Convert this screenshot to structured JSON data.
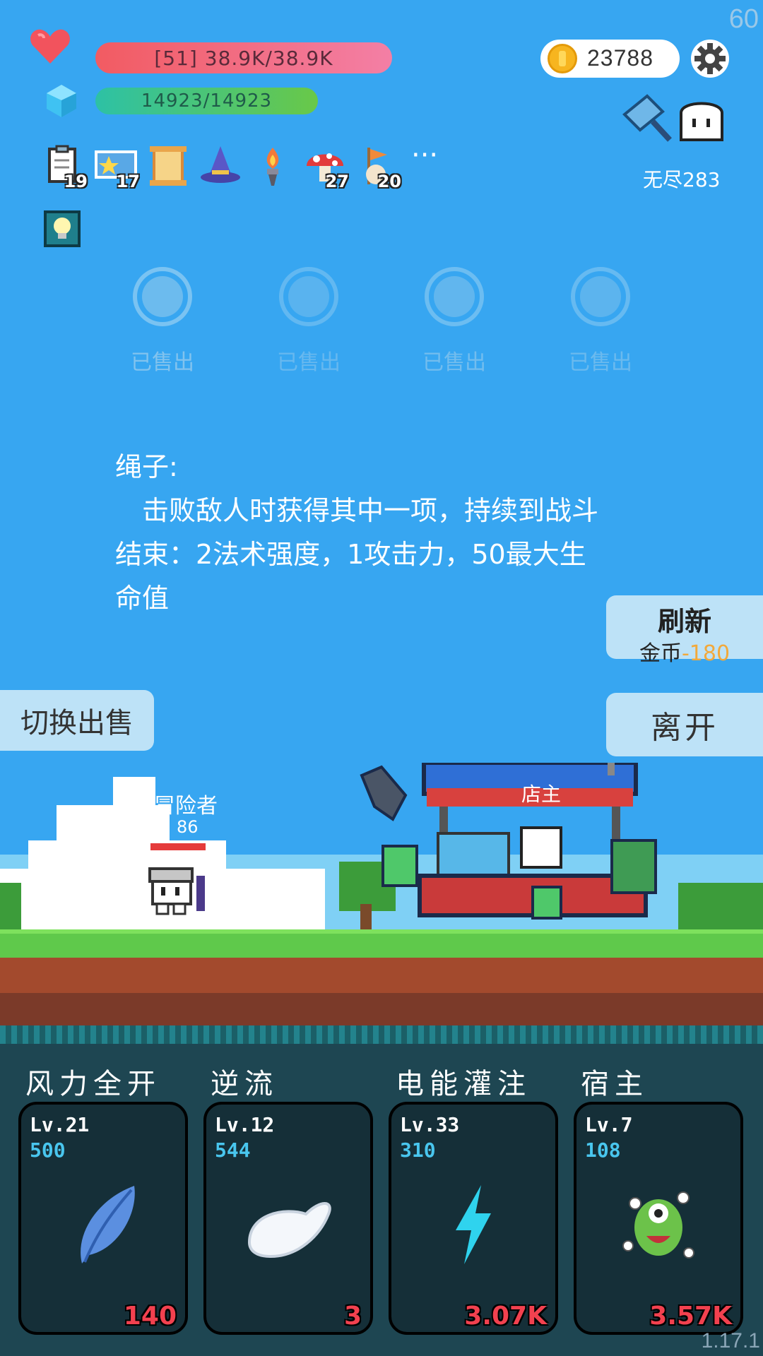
{
  "fps": "60",
  "version": "1.17.1",
  "status": {
    "hp_text": "[51] 38.9K/38.9K",
    "mp_text": "14923/14923",
    "gold": "23788"
  },
  "items": [
    {
      "icon": "quest-clipboard-icon",
      "count": "19"
    },
    {
      "icon": "star-card-icon",
      "count": "17"
    },
    {
      "icon": "scroll-icon",
      "count": ""
    },
    {
      "icon": "wizard-hat-icon",
      "count": ""
    },
    {
      "icon": "torch-icon",
      "count": ""
    },
    {
      "icon": "mushroom-icon",
      "count": "27"
    },
    {
      "icon": "flag-icon",
      "count": "20"
    }
  ],
  "more_label": "···",
  "endless_label": "无尽283",
  "shop_slots": [
    {
      "status": "已售出"
    },
    {
      "status": "已售出"
    },
    {
      "status": "已售出"
    },
    {
      "status": "已售出"
    }
  ],
  "description": {
    "title": "绳子:",
    "body": "击败敌人时获得其中一项，持续到战斗结束：2法术强度，1攻击力，50最大生命值"
  },
  "buttons": {
    "refresh_label": "刷新",
    "refresh_cost_prefix": "金币",
    "refresh_cost": "-180",
    "leave_label": "离开",
    "switch_sell_label": "切换出售"
  },
  "scene": {
    "adventurer_label": "冒险者",
    "adventurer_level": "86",
    "shopkeeper_label": "店主"
  },
  "skills": [
    {
      "name": "风力全开",
      "level": "Lv.21",
      "cost": "500",
      "value": "140",
      "icon": "feather-icon"
    },
    {
      "name": "逆流",
      "level": "Lv.12",
      "cost": "544",
      "value": "3",
      "icon": "wing-icon"
    },
    {
      "name": "电能灌注",
      "level": "Lv.33",
      "cost": "310",
      "value": "3.07K",
      "icon": "lightning-icon"
    },
    {
      "name": "宿主",
      "level": "Lv.7",
      "cost": "108",
      "value": "3.57K",
      "icon": "green-monster-icon"
    }
  ]
}
